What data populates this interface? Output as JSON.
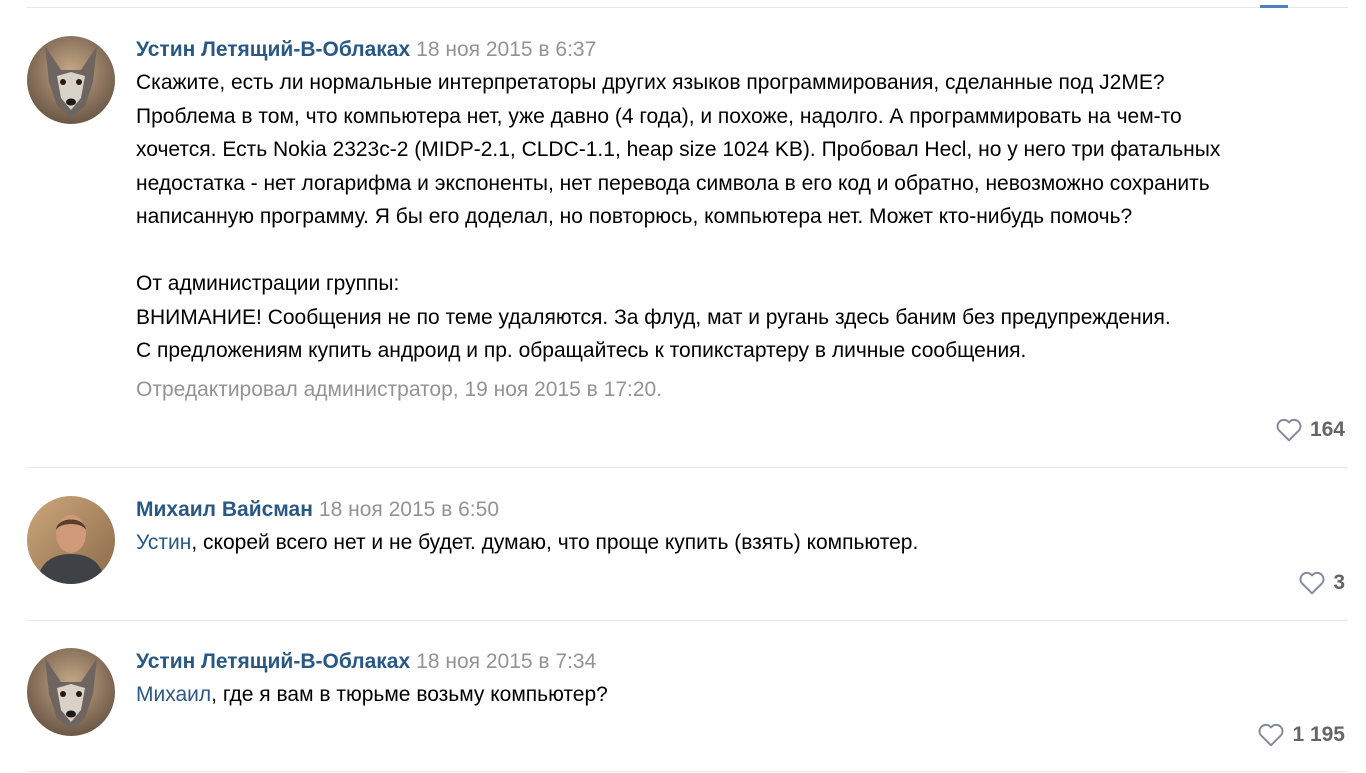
{
  "posts": [
    {
      "author": "Устин Летящий-В-Облаках",
      "date": "18 ноя 2015 в 6:37",
      "avatar": "wolf-avatar",
      "text_lines": [
        "Скажите, есть ли нормальные интерпретаторы других языков программирования, сделанные под J2ME?",
        "Проблема в том, что компьютера нет, уже давно (4 года), и похоже, надолго. А программировать на чем-то",
        "хочется. Есть Nokia 2323c-2 (MIDP-2.1, CLDC-1.1, heap size 1024 KB). Пробовал Hecl, но у него три фатальных",
        "недостатка - нет логарифма и экспоненты, нет перевода символа в его код и обратно, невозможно сохранить",
        "написанную программу. Я бы его доделал, но повторюсь, компьютера нет. Может кто-нибудь помочь?"
      ],
      "admin_lines": [
        "От администрации группы:",
        "ВНИМАНИЕ! Сообщения не по теме удаляются. За флуд, мат и ругань здесь баним без предупреждения.",
        "С предложениям купить андроид и пр. обращайтесь к топикстартеру в личные сообщения."
      ],
      "edited": "Отредактировал администратор, 19 ноя 2015 в 17:20.",
      "likes": "164"
    },
    {
      "author": "Михаил Вайсман",
      "date": "18 ноя 2015 в 6:50",
      "avatar": "man-avatar",
      "mention": "Устин",
      "text": ", скорей всего нет и не будет. думаю, что проще купить (взять) компьютер.",
      "likes": "3"
    },
    {
      "author": "Устин Летящий-В-Облаках",
      "date": "18 ноя 2015 в 7:34",
      "avatar": "wolf-avatar",
      "mention": "Михаил",
      "text": ", где я вам в тюрьме возьму компьютер?",
      "likes": "1 195"
    }
  ],
  "colors": {
    "author": "#2a5885",
    "date": "#939393",
    "separator": "#e7e8ec",
    "like": "#656565"
  },
  "icons": {
    "like": "heart-outline-icon"
  }
}
